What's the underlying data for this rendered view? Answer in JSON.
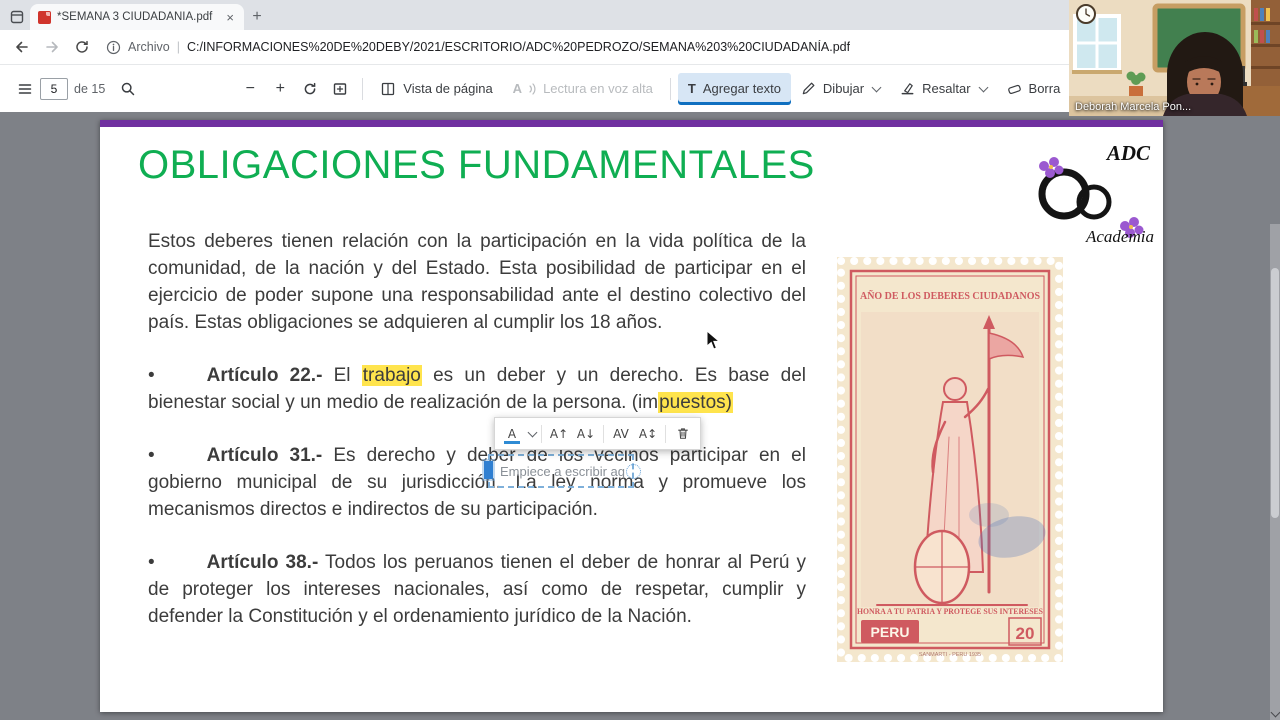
{
  "colors": {
    "purple": "#7030a0",
    "green": "#0fae52",
    "highlight": "#ffe44d",
    "stamp_red": "#cf5a60",
    "stamp_cream": "#f4e7cd",
    "accent_blue": "#1070c0",
    "viewer_gray": "#7e8187"
  },
  "browser": {
    "tab_title": "*SEMANA 3 CIUDADANÍA.pdf",
    "tab_close": "×",
    "new_tab": "+",
    "address": {
      "scheme": "Archivo",
      "sep": "|",
      "url": "C:/INFORMACIONES%20DE%20DEBY/2021/ESCRITORIO/ADC%20PEDROZO/SEMANA%203%20CIUDADANÍA.pdf"
    }
  },
  "toolbar": {
    "page_value": "5",
    "page_total": "de 15",
    "zoom_out": "−",
    "zoom_in": "+",
    "vista": "Vista de página",
    "lectura": "Lectura en voz alta",
    "lectura_icon": "A",
    "agregar": "Agregar texto",
    "agregar_icon": "T",
    "dibujar": "Dibujar",
    "resaltar": "Resaltar",
    "borrar": "Borra"
  },
  "edit_toolbar": {
    "color": "A",
    "inc": "A↑",
    "dec": "A↓",
    "track": "AV",
    "lead": "A↕"
  },
  "textbox": {
    "placeholder": "Empiece a escribir aq"
  },
  "doc": {
    "title": "OBLIGACIONES FUNDAMENTALES",
    "logo_top": "ADC",
    "logo_bottom": "Academia",
    "bullet": "•",
    "intro": "Estos deberes tienen relación con la participación en la vida política de la comunidad, de la nación y del Estado. Esta posibilidad de participar en el ejercicio de poder supone una responsabilidad ante el destino colectivo del país. Estas obligaciones se adquieren al cumplir los 18 años.",
    "art22": {
      "label": "Artículo 22.-",
      "pre": " El ",
      "hl1": "trabajo",
      "mid": " es un deber y un derecho. Es base del bienestar social y un medio de realización de la persona. (im",
      "hl2": "puestos)"
    },
    "art31": {
      "label": "Artículo 31.-",
      "text": " Es derecho y deber de los vecinos participar en el gobierno municipal de su jurisdicción. La ley norma y promueve los mecanismos directos e indirectos de su participación."
    },
    "art38": {
      "label": "Artículo 38.-",
      "text": " Todos los peruanos tienen el deber de honrar al Perú y de proteger los intereses nacionales, así como de respetar, cumplir y defender la Constitución y el ordenamiento jurídico de la Nación."
    }
  },
  "stamp": {
    "top": "AÑO DE LOS DEBERES CIUDADANOS",
    "bottom": "HONRA A TU PATRIA Y PROTEGE SUS INTERESES",
    "country": "PERU",
    "value": "20",
    "credit": "SANMARTI - PERU 1935"
  },
  "webcam": {
    "name": "Deborah Marcela Pon..."
  }
}
